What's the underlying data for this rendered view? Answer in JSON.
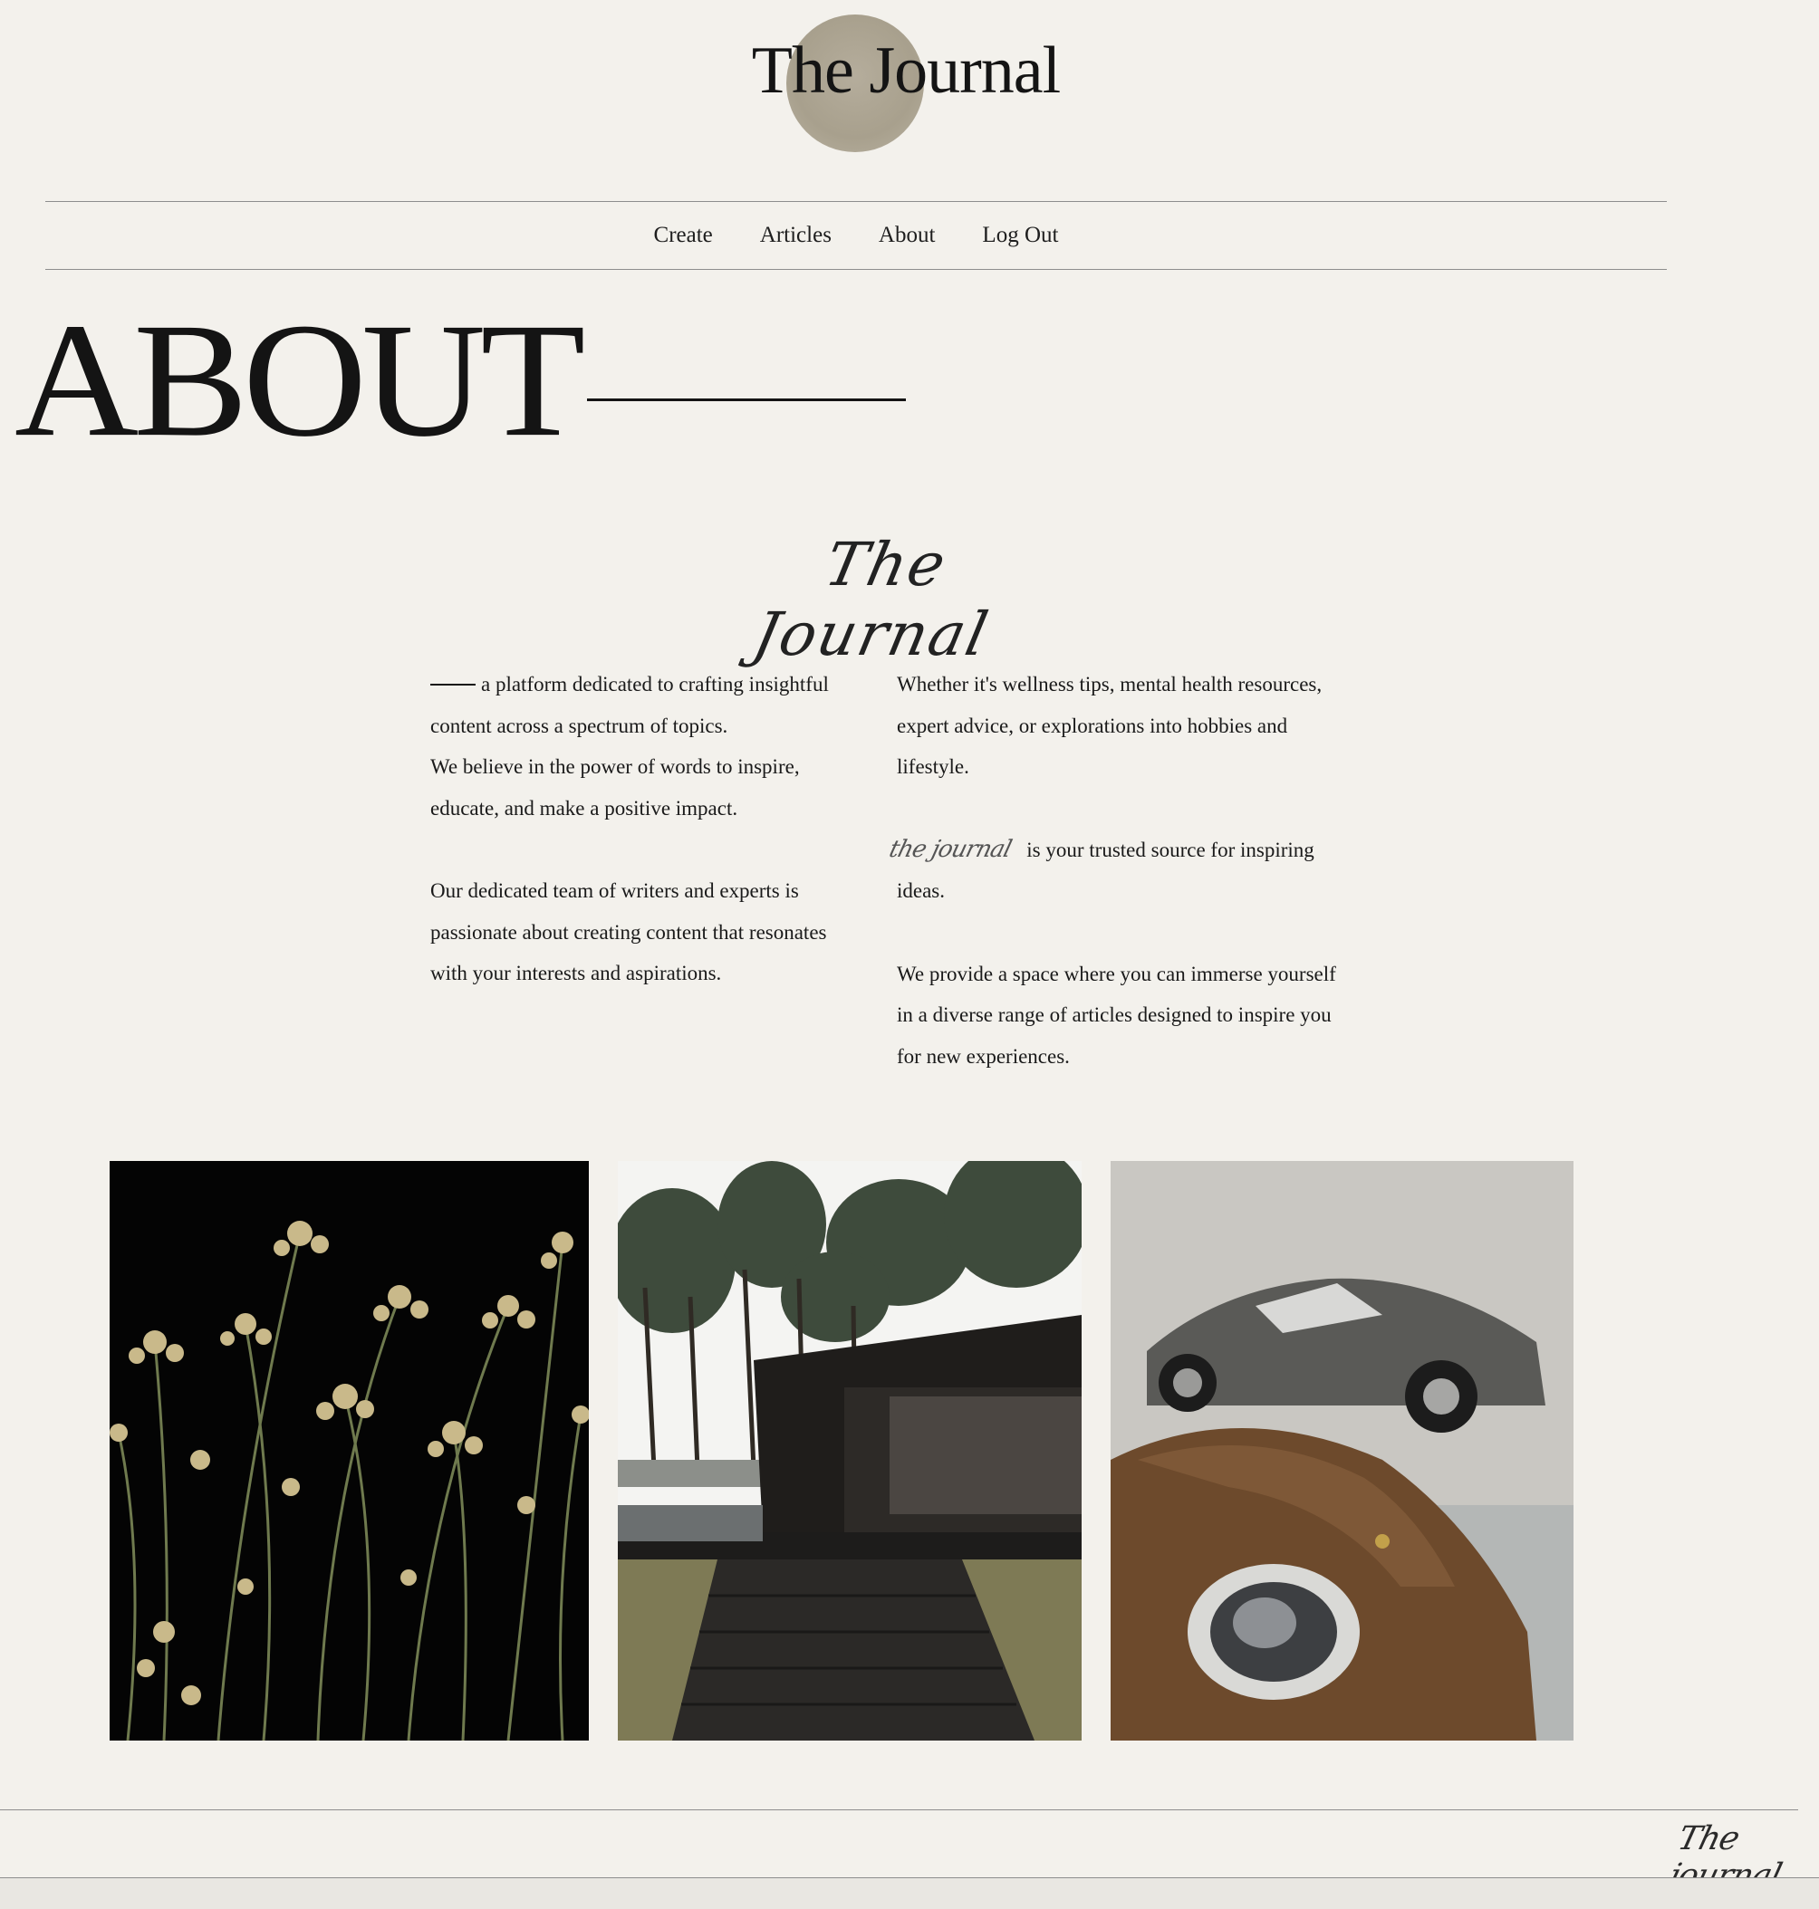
{
  "header": {
    "brand": "The Journal"
  },
  "nav": {
    "items": [
      {
        "label": "Create"
      },
      {
        "label": "Articles"
      },
      {
        "label": "About"
      },
      {
        "label": "Log Out"
      }
    ]
  },
  "about": {
    "heading": "ABOUT",
    "script_logo": "The Journal",
    "left_column": {
      "p1": "a platform dedicated to crafting insightful content across a spectrum of topics.",
      "p2": "We believe in the power of words to inspire, educate, and make a positive impact.",
      "p3": "Our dedicated team of writers and experts is passionate about creating content that resonates with your interests and aspirations."
    },
    "right_column": {
      "p1": "Whether it's wellness tips, mental health resources, expert advice, or explorations into hobbies and lifestyle.",
      "p2_script": "the journal",
      "p2": "is your trusted source for inspiring ideas.",
      "p3": "We provide a space where you can immerse yourself in a diverse range of articles designed to inspire you for new experiences."
    }
  },
  "gallery": {
    "images": [
      {
        "subject": "golden flowers on black background"
      },
      {
        "subject": "dark modern house among pine trees"
      },
      {
        "subject": "vintage sports cars in garage"
      }
    ]
  },
  "footer": {
    "script_logo": "The journal"
  }
}
